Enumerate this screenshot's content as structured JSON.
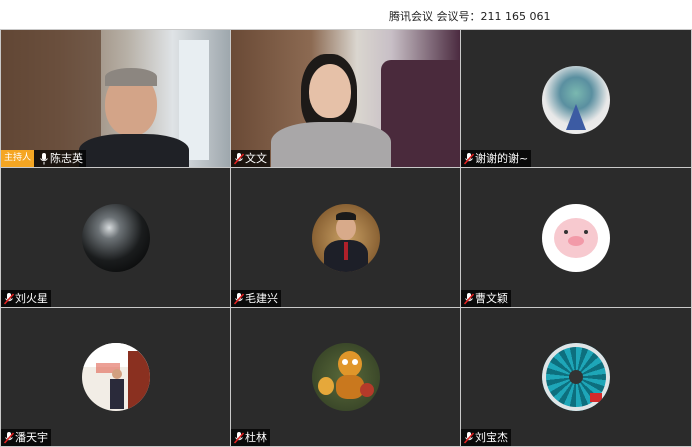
{
  "window": {
    "meeting_title": "腾讯会议 会议号：211 165 061"
  },
  "host_badge": "主持人",
  "participants": [
    {
      "name": "陈志英",
      "host": true,
      "video": true,
      "mic_icon": "mic-icon"
    },
    {
      "name": "文文",
      "host": false,
      "video": true,
      "mic_icon": "mic-muted-icon"
    },
    {
      "name": "谢谢的谢~",
      "host": false,
      "video": false,
      "avatar": "flower-bouquet",
      "mic_icon": "mic-muted-icon"
    },
    {
      "name": "刘火星",
      "host": false,
      "video": false,
      "avatar": "glass-sphere",
      "mic_icon": "mic-muted-icon"
    },
    {
      "name": "毛建兴",
      "host": false,
      "video": false,
      "avatar": "portrait-suit",
      "mic_icon": "mic-muted-icon"
    },
    {
      "name": "曹文颖",
      "host": false,
      "video": false,
      "avatar": "pink-pig-cartoon",
      "mic_icon": "mic-muted-icon"
    },
    {
      "name": "潘天宇",
      "host": false,
      "video": false,
      "avatar": "office-presentation",
      "mic_icon": "mic-muted-icon"
    },
    {
      "name": "杜林",
      "host": false,
      "video": false,
      "avatar": "cartoon-figurines",
      "mic_icon": "mic-muted-icon"
    },
    {
      "name": "刘宝杰",
      "host": false,
      "video": false,
      "avatar": "turbine-fan",
      "mic_icon": "mic-muted-icon"
    }
  ],
  "colors": {
    "tile_background": "#2b2b2b",
    "host_badge": "#f5a623",
    "muted_mic": "#e02020"
  }
}
